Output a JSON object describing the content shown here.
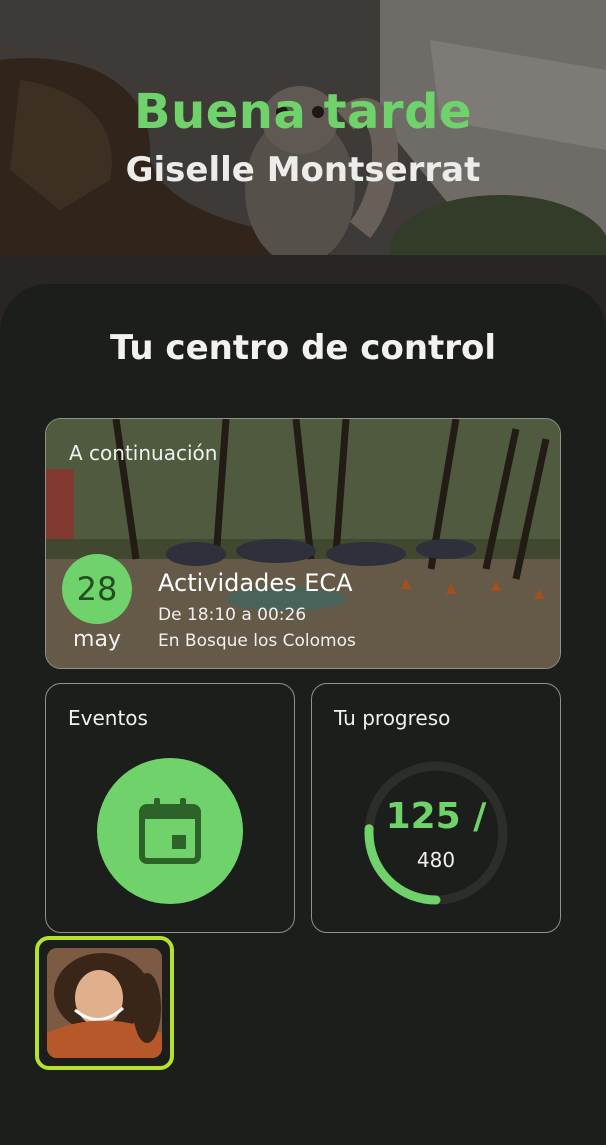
{
  "header": {
    "greeting": "Buena tarde",
    "user_name": "Giselle Montserrat"
  },
  "dashboard": {
    "title": "Tu centro de control"
  },
  "next_event": {
    "label": "A continuación",
    "day": "28",
    "month": "may",
    "title": "Actividades ECA",
    "time": "De 18:10 a 00:26",
    "place": "En Bosque los Colomos"
  },
  "events_card": {
    "label": "Eventos",
    "icon": "calendar-icon"
  },
  "progress_card": {
    "label": "Tu progreso",
    "current": "125 /",
    "total": "480",
    "fraction": 0.26
  },
  "colors": {
    "accent": "#6fd26b",
    "highlight": "#b6e22e",
    "background": "#1c1e1b"
  }
}
